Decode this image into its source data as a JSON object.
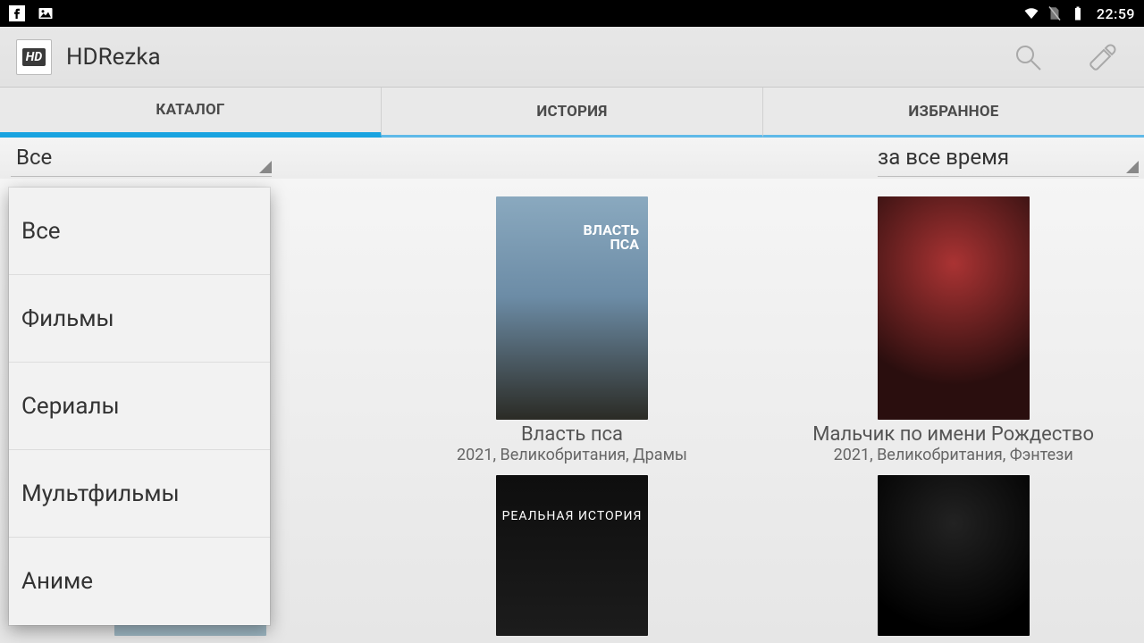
{
  "status": {
    "time": "22:59"
  },
  "app": {
    "title": "HDRezka",
    "icon_text": "HD"
  },
  "tabs": [
    {
      "label": "КАТАЛОГ",
      "active": true
    },
    {
      "label": "ИСТОРИЯ",
      "active": false
    },
    {
      "label": "ИЗБРАННОЕ",
      "active": false
    }
  ],
  "filters": {
    "category": {
      "selected": "Все"
    },
    "period": {
      "selected": "за все время"
    }
  },
  "dropdown": {
    "options": [
      "Все",
      "Фильмы",
      "Сериалы",
      "Мультфильмы",
      "Аниме"
    ]
  },
  "cards": [
    {
      "title": "Власть пса",
      "meta": "2021, Великобритания, Драмы",
      "poster_label": "ВЛАСТЬ\nПСА"
    },
    {
      "title": "Мальчик по имени Рождество",
      "meta": "2021, Великобритания, Фэнтези",
      "poster_label": ""
    },
    {
      "title": "",
      "meta": "",
      "poster_label": "РЕАЛЬНАЯ ИСТОРИЯ"
    },
    {
      "title": "",
      "meta": "",
      "poster_label": ""
    }
  ]
}
